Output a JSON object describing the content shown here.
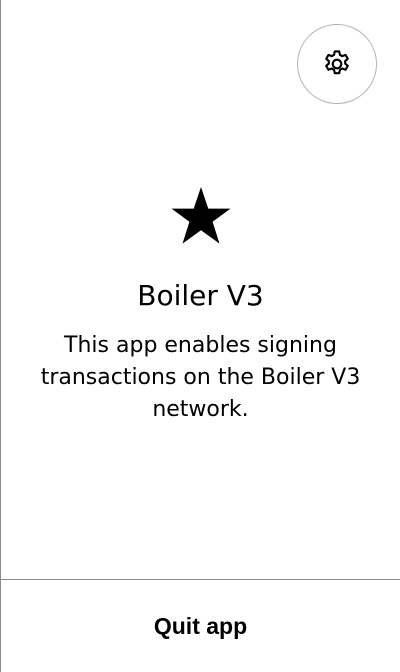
{
  "header": {
    "settings_icon": "gear-icon"
  },
  "app": {
    "icon": "star-icon",
    "name": "Boiler V3",
    "description": "This app enables signing transactions on the Boiler V3 network."
  },
  "footer": {
    "quit_label": "Quit app"
  },
  "colors": {
    "background": "#ffffff",
    "text": "#000000",
    "divider": "#8c8c8c",
    "button_border": "#b3b3b3"
  }
}
